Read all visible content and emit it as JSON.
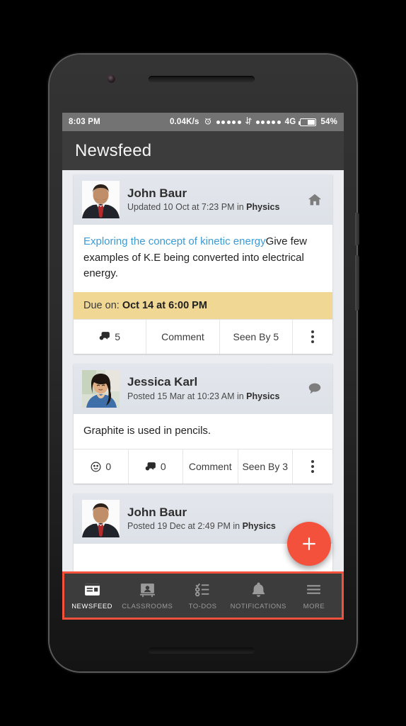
{
  "status_bar": {
    "time": "8:03 PM",
    "data_rate": "0.04K/s",
    "alarm_icon": "alarm-clock-icon",
    "network_type": "4G",
    "battery_percent": "54%"
  },
  "app_bar": {
    "title": "Newsfeed"
  },
  "posts": [
    {
      "author": "John Baur",
      "meta_prefix": "Updated 10 Oct at 7:23 PM in ",
      "classroom": "Physics",
      "header_icon": "home-icon",
      "avatar": "man-dark-suit-red-tie-avatar",
      "title": "Exploring the concept of kinetic energy",
      "body": "Give few examples of K.E being converted into electrical energy.",
      "due_label": "Due on: ",
      "due_value": "Oct 14 at 6:00 PM",
      "actions": [
        {
          "icon": "comment-bubble-icon",
          "label": "5"
        },
        {
          "icon": "",
          "label": "Comment"
        },
        {
          "icon": "",
          "label": "Seen By 5"
        },
        {
          "icon": "kebab-menu-icon",
          "label": ""
        }
      ]
    },
    {
      "author": "Jessica Karl",
      "meta_prefix": "Posted 15 Mar at 10:23 AM in ",
      "classroom": "Physics",
      "header_icon": "speech-bubble-icon",
      "avatar": "woman-blue-top-avatar",
      "title": "",
      "body": "Graphite is used in pencils.",
      "due_label": "",
      "due_value": "",
      "actions": [
        {
          "icon": "smiley-icon",
          "label": "0"
        },
        {
          "icon": "comment-bubble-icon",
          "label": "0"
        },
        {
          "icon": "",
          "label": "Comment"
        },
        {
          "icon": "",
          "label": "Seen By 3"
        },
        {
          "icon": "kebab-menu-icon",
          "label": ""
        }
      ]
    },
    {
      "author": "John Baur",
      "meta_prefix": "Posted 19 Dec at 2:49 PM in ",
      "classroom": "Physics",
      "header_icon": "",
      "avatar": "man-dark-suit-red-tie-avatar",
      "title": "",
      "body": "",
      "due_label": "",
      "due_value": "",
      "actions": []
    }
  ],
  "fab": {
    "icon": "plus-icon",
    "label": "+"
  },
  "bottom_nav": {
    "active_index": 0,
    "items": [
      {
        "label": "NEWSFEED",
        "icon": "newsfeed-icon"
      },
      {
        "label": "CLASSROOMS",
        "icon": "classrooms-icon"
      },
      {
        "label": "TO-DOS",
        "icon": "todos-icon"
      },
      {
        "label": "NOTIFICATIONS",
        "icon": "bell-icon"
      },
      {
        "label": "MORE",
        "icon": "hamburger-icon"
      }
    ]
  },
  "colors": {
    "accent": "#f4513d",
    "app_bar": "#3c3c3c",
    "due_bar": "#f0d793",
    "link": "#3c9bd6",
    "page_bg": "#ecedf1"
  }
}
